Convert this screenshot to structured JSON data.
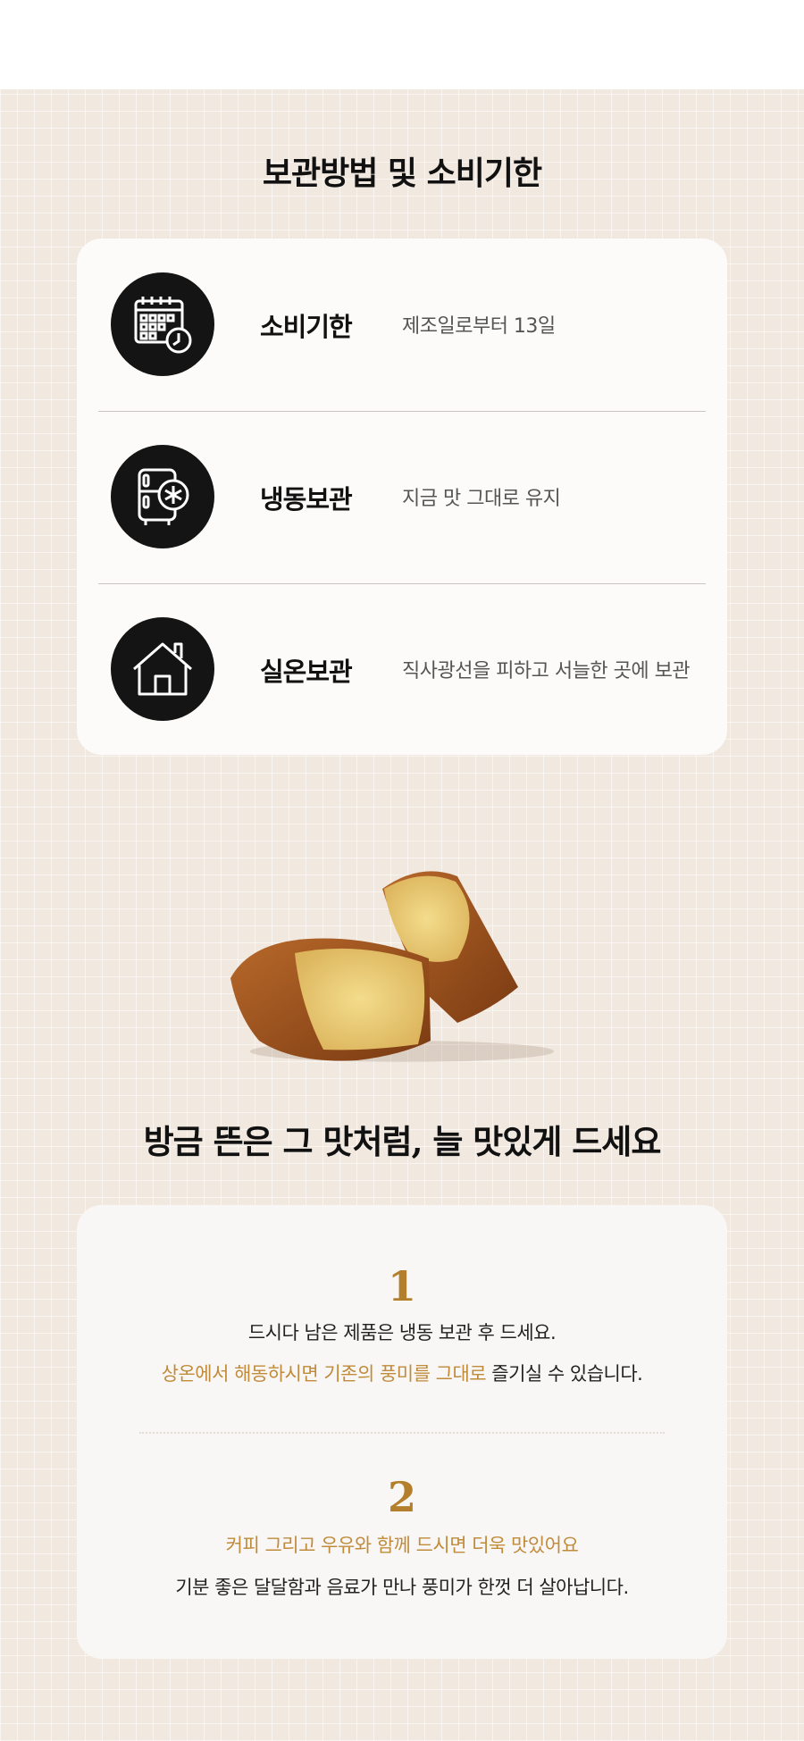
{
  "storage_section": {
    "title": "보관방법 및 소비기한",
    "rows": [
      {
        "icon": "calendar-clock-icon",
        "label": "소비기한",
        "value": "제조일로부터 13일"
      },
      {
        "icon": "freezer-icon",
        "label": "냉동보관",
        "value": "지금 맛 그대로 유지"
      },
      {
        "icon": "house-icon",
        "label": "실온보관",
        "value": "직사광선을 피하고 서늘한 곳에 보관"
      }
    ]
  },
  "tips_section": {
    "title": "방금 뜬은 그 맛처럼, 늘 맛있게 드세요",
    "tips": [
      {
        "number": "1",
        "line1": "드시다 남은 제품은 냉동 보관 후 드세요.",
        "line2_highlight": "상온에서 해동하시면 기존의 풍미를 그대로",
        "line2_rest": " 즐기실 수 있습니다."
      },
      {
        "number": "2",
        "line1": "커피 그리고 우유와 함께 드시면 더욱 맛있어요",
        "line2": "기분 좋은 달달함과 음료가 만나 풍미가 한껏 더 살아납니다."
      }
    ]
  },
  "colors": {
    "background": "#f1e8e0",
    "accent_gold": "#b37f2c",
    "icon_circle": "#141414"
  }
}
